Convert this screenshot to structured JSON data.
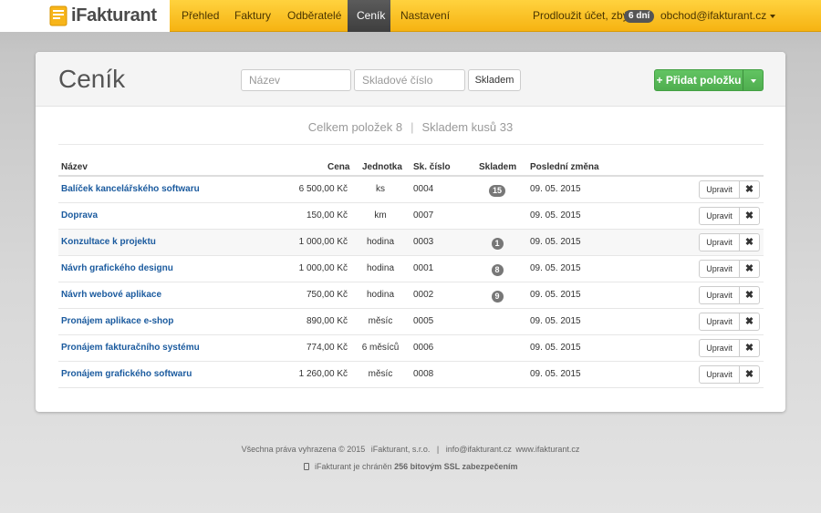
{
  "brand": {
    "name": "iFakturant",
    "logo_icon": "invoice-logo-icon"
  },
  "nav": {
    "items": [
      {
        "label": "Přehled",
        "active": false
      },
      {
        "label": "Faktury",
        "active": false
      },
      {
        "label": "Odběratelé",
        "active": false
      },
      {
        "label": "Ceník",
        "active": true
      },
      {
        "label": "Nastavení",
        "active": false
      }
    ],
    "extend_text": "Prodloužit účet, zbývá",
    "days_left": "6 dní",
    "account_email": "obchod@ifakturant.cz"
  },
  "page": {
    "title": "Ceník",
    "search_name_placeholder": "Název",
    "search_code_placeholder": "Skladové číslo",
    "stock_button": "Skladem",
    "add_button": "Přidat položku"
  },
  "summary": {
    "total_items": "Celkem položek 8",
    "separator": "|",
    "stock_units": "Skladem kusů 33"
  },
  "table": {
    "headers": {
      "name": "Název",
      "price": "Cena",
      "unit": "Jednotka",
      "code": "Sk. číslo",
      "stock": "Skladem",
      "last_change": "Poslední změna"
    },
    "edit_label": "Upravit",
    "delete_label": "✖",
    "rows": [
      {
        "name": "Balíček kancelářského softwaru",
        "price": "6 500,00 Kč",
        "unit": "ks",
        "code": "0004",
        "stock": "15",
        "date": "09. 05. 2015"
      },
      {
        "name": "Doprava",
        "price": "150,00 Kč",
        "unit": "km",
        "code": "0007",
        "stock": "",
        "date": "09. 05. 2015"
      },
      {
        "name": "Konzultace k projektu",
        "price": "1 000,00 Kč",
        "unit": "hodina",
        "code": "0003",
        "stock": "1",
        "date": "09. 05. 2015"
      },
      {
        "name": "Návrh grafického designu",
        "price": "1 000,00 Kč",
        "unit": "hodina",
        "code": "0001",
        "stock": "8",
        "date": "09. 05. 2015"
      },
      {
        "name": "Návrh webové aplikace",
        "price": "750,00 Kč",
        "unit": "hodina",
        "code": "0002",
        "stock": "9",
        "date": "09. 05. 2015"
      },
      {
        "name": "Pronájem aplikace e-shop",
        "price": "890,00 Kč",
        "unit": "měsíc",
        "code": "0005",
        "stock": "",
        "date": "09. 05. 2015"
      },
      {
        "name": "Pronájem fakturačního systému",
        "price": "774,00 Kč",
        "unit": "6 měsíců",
        "code": "0006",
        "stock": "",
        "date": "09. 05. 2015"
      },
      {
        "name": "Pronájem grafického softwaru",
        "price": "1 260,00 Kč",
        "unit": "měsíc",
        "code": "0008",
        "stock": "",
        "date": "09. 05. 2015"
      }
    ]
  },
  "footer": {
    "rights": "Všechna práva vyhrazena © 2015",
    "company": "iFakturant, s.r.o.",
    "email": "info@ifakturant.cz",
    "website": "www.ifakturant.cz",
    "ssl_prefix": "iFakturant je chráněn",
    "ssl_strong": "256 bitovým SSL zabezpečením"
  },
  "colors": {
    "navbar": "#f6b312",
    "success": "#5cb85c",
    "link": "#1a5a9e",
    "badge": "#777777"
  }
}
